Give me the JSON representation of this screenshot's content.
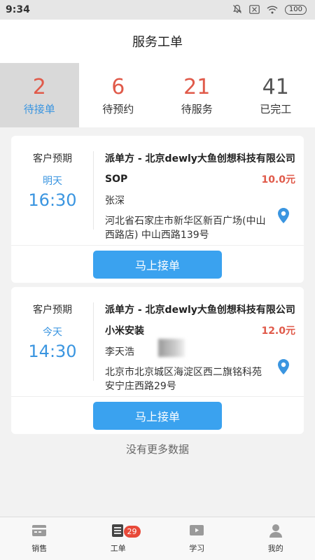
{
  "status_bar": {
    "time": "9:34",
    "battery": "100"
  },
  "header": {
    "title": "服务工单"
  },
  "tabs": [
    {
      "count": "2",
      "label": "待接单",
      "active": true
    },
    {
      "count": "6",
      "label": "待预约"
    },
    {
      "count": "21",
      "label": "待服务"
    },
    {
      "count": "41",
      "label": "已完工"
    }
  ],
  "orders": [
    {
      "eta_label": "客户预期",
      "day": "明天",
      "time": "16:30",
      "dispatcher": "派单方 - 北京dewly大鱼创想科技有限公司",
      "service": "SOP",
      "price": "10.0元",
      "customer": "张深",
      "address": "河北省石家庄市新华区新百广场(中山西路店) 中山西路139号",
      "button": "马上接单"
    },
    {
      "eta_label": "客户预期",
      "day": "今天",
      "time": "14:30",
      "dispatcher": "派单方 - 北京dewly大鱼创想科技有限公司",
      "service": "小米安装",
      "price": "12.0元",
      "customer": "李天浩",
      "address": "北京市北京城区海淀区西二旗铭科苑 安宁庄西路29号",
      "button": "马上接单"
    }
  ],
  "footer_note": "没有更多数据",
  "bottom_nav": [
    {
      "label": "销售",
      "icon": "sales-icon"
    },
    {
      "label": "工单",
      "icon": "workorder-icon",
      "badge": "29"
    },
    {
      "label": "学习",
      "icon": "study-icon"
    },
    {
      "label": "我的",
      "icon": "profile-icon"
    }
  ],
  "colors": {
    "accent": "#3a95e0",
    "count_red": "#e05a4a",
    "button_blue": "#3aa2ef",
    "badge_red": "#e84a3a"
  }
}
